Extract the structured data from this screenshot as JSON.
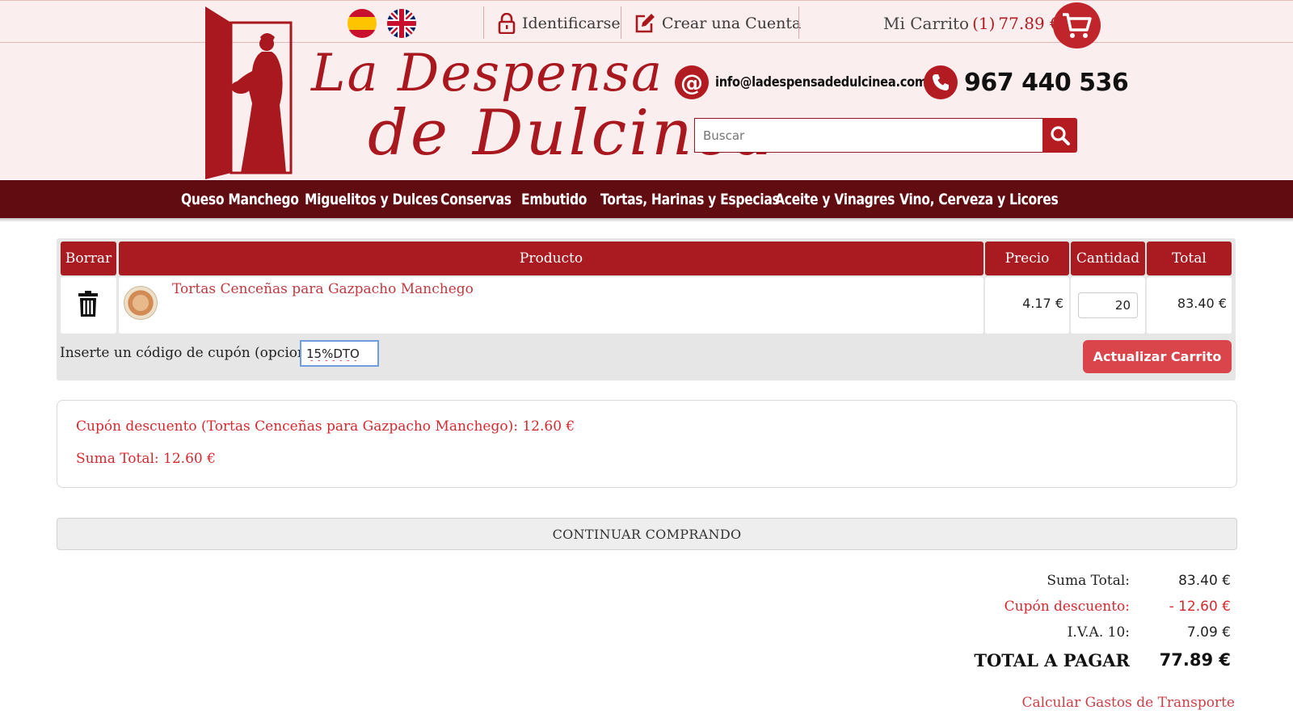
{
  "header": {
    "languages": [
      {
        "name": "Español",
        "icon": "spain-flag-icon"
      },
      {
        "name": "English",
        "icon": "uk-flag-icon"
      }
    ],
    "login_label": "Identificarse",
    "register_label": "Crear una Cuenta",
    "cart_label": "Mi Carrito",
    "cart_count": "(1)",
    "cart_amount": "77.89 €",
    "brand_line1": "La Despensa",
    "brand_line2": "de Dulcinea",
    "email": "info@ladespensadedulcinea.com",
    "phone": "967 440 536",
    "search_placeholder": "Buscar"
  },
  "nav": [
    "Queso Manchego",
    "Miguelitos y Dulces",
    "Conservas",
    "Embutido",
    "Tortas, Harinas y Especias",
    "Aceite y Vinagres",
    "Vino, Cerveza y Licores"
  ],
  "cart": {
    "headers": {
      "delete": "Borrar",
      "product": "Producto",
      "price": "Precio",
      "quantity": "Cantidad",
      "total": "Total"
    },
    "items": [
      {
        "name": "Tortas Cenceñas para Gazpacho Manchego",
        "price": "4.17 €",
        "quantity": "20",
        "total": "83.40 €"
      }
    ],
    "coupon_label": "Inserte un código de cupón (opcional)",
    "coupon_value": "15%DTO",
    "update_button": "Actualizar Carrito"
  },
  "discount": {
    "coupon_line": "Cupón descuento (Tortas Cenceñas para Gazpacho Manchego): 12.60 €",
    "sum_line": "Suma Total: 12.60 €"
  },
  "continue_button": "CONTINUAR COMPRANDO",
  "totals": {
    "subtotal_label": "Suma Total:",
    "subtotal_value": "83.40 €",
    "discount_label": "Cupón descuento:",
    "discount_value": "- 12.60 €",
    "vat_label": "I.V.A. 10:",
    "vat_value": "7.09 €",
    "grand_label": "TOTAL A PAGAR",
    "grand_value": "77.89 €"
  },
  "shipping_link": "Calcular Gastos de Transporte",
  "colors": {
    "brand_red": "#a91b20",
    "nav_dark": "#600c10",
    "header_bg": "#fbeeee",
    "link_red": "#d42a2f"
  }
}
